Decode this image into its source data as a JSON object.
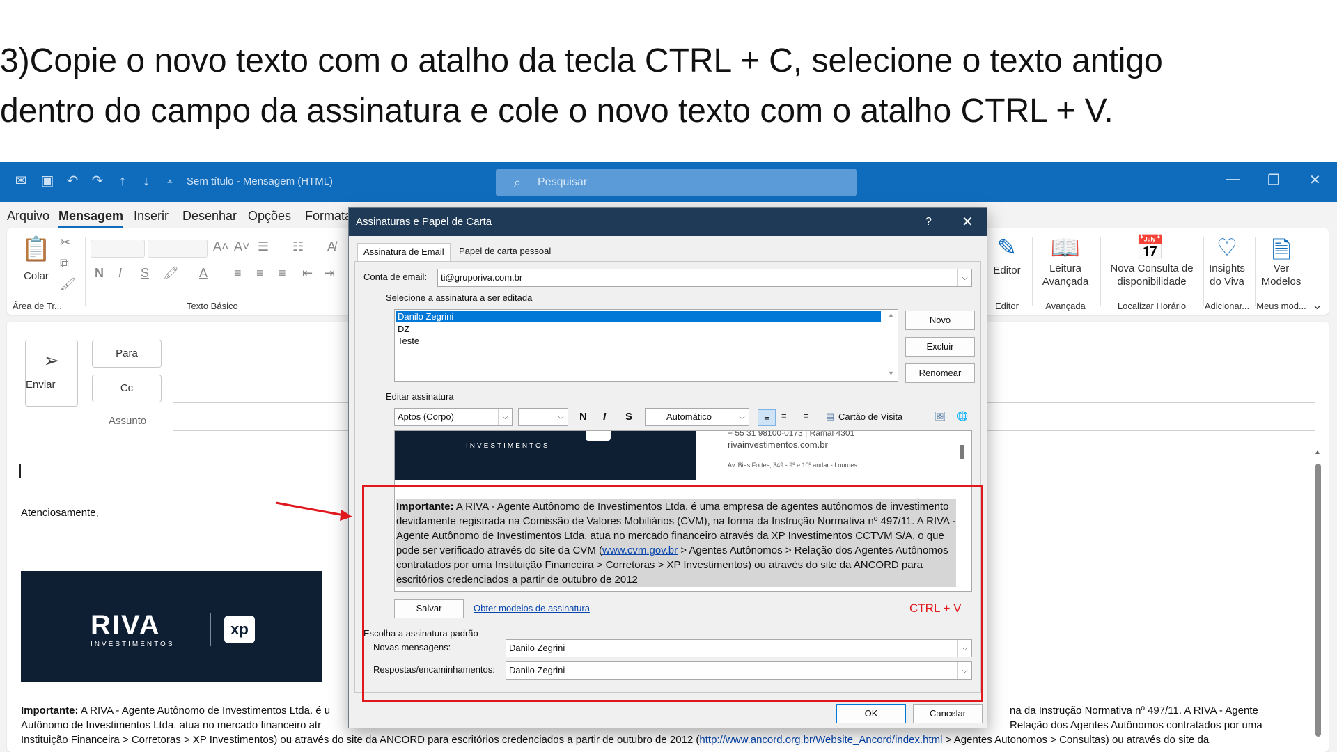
{
  "instruction": {
    "line1": "3)Copie o novo texto com o atalho da tecla CTRL + C, selecione o texto antigo",
    "line2": "dentro do campo da assinatura e cole o novo texto com o atalho CTRL + V."
  },
  "titlebar": {
    "title": "Sem título  -  Mensagem (HTML)",
    "search_placeholder": "Pesquisar"
  },
  "menu": [
    "Arquivo",
    "Mensagem",
    "Inserir",
    "Desenhar",
    "Opções",
    "Formata"
  ],
  "ribbon": {
    "paste_label": "Colar",
    "clipboard_group": "Área de Tr...",
    "basic_text_group": "Texto Básico",
    "editor_label": "Editor",
    "editor_group": "Editor",
    "reader_label1": "Leitura",
    "reader_label2": "Avançada",
    "reader_group": "Avançada",
    "schedule_label1": "Nova Consulta de",
    "schedule_label2": "disponibilidade",
    "schedule_group": "Localizar Horário",
    "insights_label1": "Insights",
    "insights_label2": "do Viva",
    "insights_group": "Adicionar...",
    "templates_label1": "Ver",
    "templates_label2": "Modelos",
    "templates_group": "Meus mod...",
    "bold": "N",
    "italic": "I",
    "underline": "S"
  },
  "compose": {
    "send": "Enviar",
    "to": "Para",
    "cc": "Cc",
    "subject": "Assunto",
    "closing": "Atenciosamente,",
    "logo_name": "RIVA",
    "logo_sub": "INVESTIMENTOS",
    "logo_xp": "xp",
    "body_important": "Importante:",
    "body_l1a": " A RIVA - Agente Autônomo de Investimentos Ltda. é u",
    "body_l1b": "na da Instrução Normativa nº 497/11. A RIVA - Agente",
    "body_l2a": "Autônomo de Investimentos Ltda. atua no mercado financeiro atr",
    "body_l2b": "Relação dos Agentes Autônomos contratados por uma",
    "body_l3a": "Instituição Financeira > Corretoras > XP Investimentos) ou através do site da ANCORD para escritórios credenciados a partir de outubro de 2012 (",
    "body_l3_link": "http://www.ancord.org.br/Website_Ancord/index.html",
    "body_l3b": " > Agentes Autonomos > Consultas) ou através do site da"
  },
  "dialog": {
    "title": "Assinaturas e Papel de Carta",
    "tab_email": "Assinatura de Email",
    "tab_paper": "Papel de carta pessoal",
    "account_label": "Conta de email:",
    "account_value": "ti@gruporiva.com.br",
    "select_label": "Selecione a assinatura a ser editada",
    "signatures": [
      "Danilo Zegrini",
      "DZ",
      "Teste"
    ],
    "btn_new": "Novo",
    "btn_delete": "Excluir",
    "btn_rename": "Renomear",
    "edit_label": "Editar assinatura",
    "font_name": "Aptos (Corpo)",
    "font_size": "",
    "color": "Automático",
    "bold": "N",
    "italic": "I",
    "underline": "S",
    "business_card": "Cartão de Visita",
    "sig_logo": "INVESTIMENTOS",
    "sig_phone": "+ 55 31 98100-0173 | Ramal 4301",
    "sig_site": "rivainvestimentos.com.br",
    "sig_address": "Av. Bias Fortes, 349 - 9º e 10º andar - Lourdes",
    "important_label": "Importante:",
    "important_text1": " A RIVA - Agente Autônomo de Investimentos Ltda. é uma empresa de agentes autônomos de investimento devidamente registrada na Comissão de Valores Mobiliários (CVM), na forma da Instrução Normativa nº 497/11. A RIVA - Agente Autônomo de Investimentos Ltda. atua no mercado financeiro através da XP Investimentos CCTVM S/A, o que pode ser verificado através do site da CVM (",
    "important_link": "www.cvm.gov.br",
    "important_text2": " > Agentes Autônomos > Relação dos Agentes Autônomos contratados por uma Instituição Financeira > Corretoras > XP Investimentos) ou através do site da ANCORD para escritórios credenciados a partir de outubro de 2012",
    "btn_save": "Salvar",
    "get_templates": "Obter modelos de assinatura",
    "annotation": "CTRL + V",
    "default_label": "Escolha a assinatura padrão",
    "new_msgs_label": "Novas mensagens:",
    "new_msgs_value": "Danilo Zegrini",
    "replies_label": "Respostas/encaminhamentos:",
    "replies_value": "Danilo Zegrini",
    "ok": "OK",
    "cancel": "Cancelar"
  },
  "colors": {
    "titlebar": "#0f6cbd",
    "dialog_title": "#1e3a57",
    "annotation_red": "#e0181e",
    "logo_bg": "#0e1f33"
  }
}
